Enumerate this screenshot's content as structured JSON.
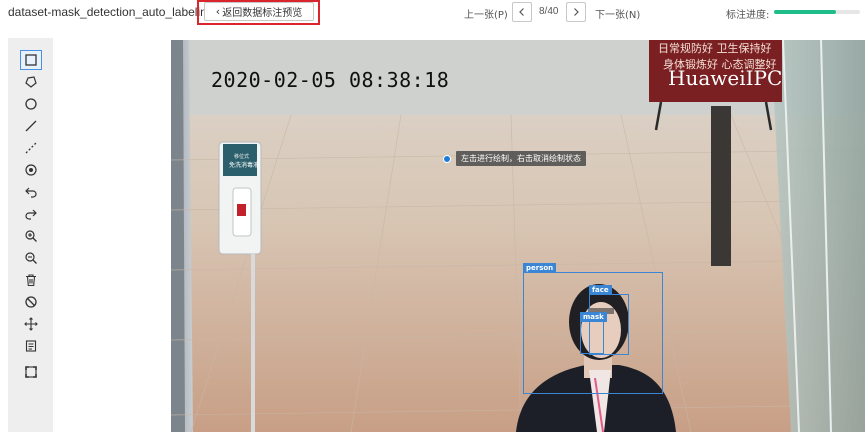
{
  "header": {
    "dataset_name": "dataset-mask_detection_auto_labeling",
    "back_label": "返回数据标注预览",
    "prev_label": "上一张(P)",
    "page_indicator": "8/40",
    "next_label": "下一张(N)",
    "progress_label": "标注进度:",
    "progress_fraction": 0.72
  },
  "toolbar": {
    "tools": [
      {
        "name": "rectangle-tool",
        "icon": "square-icon",
        "active": true
      },
      {
        "name": "polygon-tool",
        "icon": "polygon-icon"
      },
      {
        "name": "circle-tool",
        "icon": "circle-icon"
      },
      {
        "name": "line-tool",
        "icon": "line-icon"
      },
      {
        "name": "dashed-line-tool",
        "icon": "dashed-line-icon"
      },
      {
        "name": "point-tool",
        "icon": "point-icon"
      },
      {
        "name": "undo-tool",
        "icon": "undo-icon"
      },
      {
        "name": "redo-tool",
        "icon": "redo-icon"
      },
      {
        "name": "zoom-in-tool",
        "icon": "zoom-in-icon"
      },
      {
        "name": "zoom-out-tool",
        "icon": "zoom-out-icon"
      },
      {
        "name": "delete-tool",
        "icon": "trash-icon"
      },
      {
        "name": "hide-tool",
        "icon": "hide-icon"
      },
      {
        "name": "move-tool",
        "icon": "move-icon"
      },
      {
        "name": "label-list-tool",
        "icon": "list-icon"
      },
      {
        "name": "fit-screen-tool",
        "icon": "fit-screen-icon"
      }
    ]
  },
  "canvas": {
    "timestamp": "2020-02-05  08:38:18",
    "camera_brand": "HuaweiIPC",
    "banner_line1": "日常规防好  卫生保持好",
    "banner_line2": "身体锻炼好  心态调整好",
    "dispenser_line1": "移位式",
    "dispenser_line2": "免洗消毒液",
    "hint": "左击进行绘制，右击取消绘制状态",
    "annotations": [
      {
        "label": "person"
      },
      {
        "label": "face"
      },
      {
        "label": "mask"
      }
    ]
  },
  "colors": {
    "accent": "#3a86d4",
    "highlight_box": "#d9262c",
    "progress": "#1fbd8a"
  }
}
